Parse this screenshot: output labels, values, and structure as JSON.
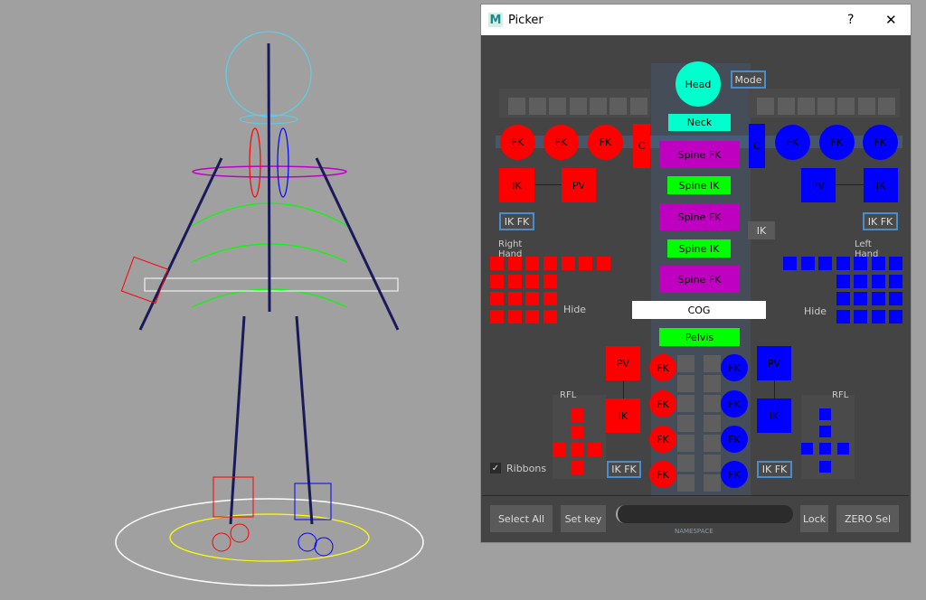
{
  "window": {
    "title": "Picker",
    "help": "?",
    "close": "✕",
    "app_icon": "maya-m-icon"
  },
  "colors": {
    "right": "#ff0000",
    "left": "#0000ff",
    "spine_fk": "#c000c0",
    "spine_ik": "#00ff00",
    "head": "#00ffcc",
    "outline": "#4a8ccc"
  },
  "center": {
    "head": "Head",
    "mode": "Mode",
    "neck": "Neck",
    "spine_fk": "Spine FK",
    "spine_ik": "Spine IK",
    "ik": "IK",
    "cog": "COG",
    "pelvis": "Pelvis"
  },
  "arms": {
    "fk": "FK",
    "clavicle": "C",
    "ik": "IK",
    "pv": "PV",
    "ikfk": "IK FK",
    "right_hand": "Right Hand",
    "left_hand": "Left Hand",
    "hide": "Hide"
  },
  "legs": {
    "fk": "FK",
    "ik": "IK",
    "pv": "PV",
    "ikfk": "IK FK",
    "rfl": "RFL"
  },
  "ribbons": {
    "label": "Ribbons",
    "checked": true
  },
  "footer": {
    "select_all": "Select All",
    "set_key": "Set key",
    "namespace_value": "",
    "namespace_label": "NAMESPACE",
    "lock": "Lock",
    "zero_sel": "ZERO Sel"
  }
}
